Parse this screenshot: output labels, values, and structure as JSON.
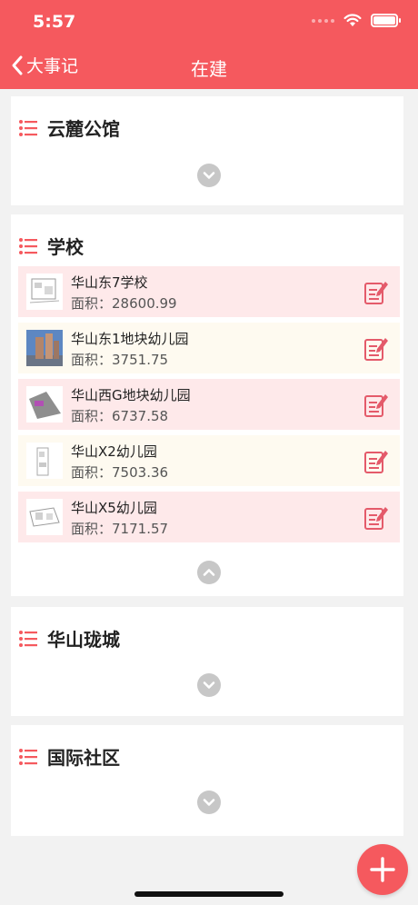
{
  "status_bar": {
    "time": "5:57"
  },
  "nav": {
    "back_label": "大事记",
    "title": "在建"
  },
  "colors": {
    "accent": "#f5595e",
    "item_pink": "#fee9ea",
    "item_cream": "#fefaf0",
    "chevron": "#c7c7c7"
  },
  "groups": [
    {
      "title": "云麓公馆",
      "expanded": false
    },
    {
      "title": "学校",
      "expanded": true,
      "items": [
        {
          "name": "华山东7学校",
          "area_label": "面积：",
          "area": "28600.99"
        },
        {
          "name": "华山东1地块幼儿园",
          "area_label": "面积：",
          "area": "3751.75"
        },
        {
          "name": "华山西G地块幼儿园",
          "area_label": "面积：",
          "area": "6737.58"
        },
        {
          "name": "华山X2幼儿园",
          "area_label": "面积：",
          "area": "7503.36"
        },
        {
          "name": "华山X5幼儿园",
          "area_label": "面积：",
          "area": "7171.57"
        }
      ]
    },
    {
      "title": "华山珑城",
      "expanded": false
    },
    {
      "title": "国际社区",
      "expanded": false
    }
  ],
  "icons": {
    "back": "chevron-left-icon",
    "list": "list-icon",
    "edit": "edit-icon",
    "expand": "chevron-down-icon",
    "collapse": "chevron-up-icon",
    "add": "plus-icon"
  }
}
